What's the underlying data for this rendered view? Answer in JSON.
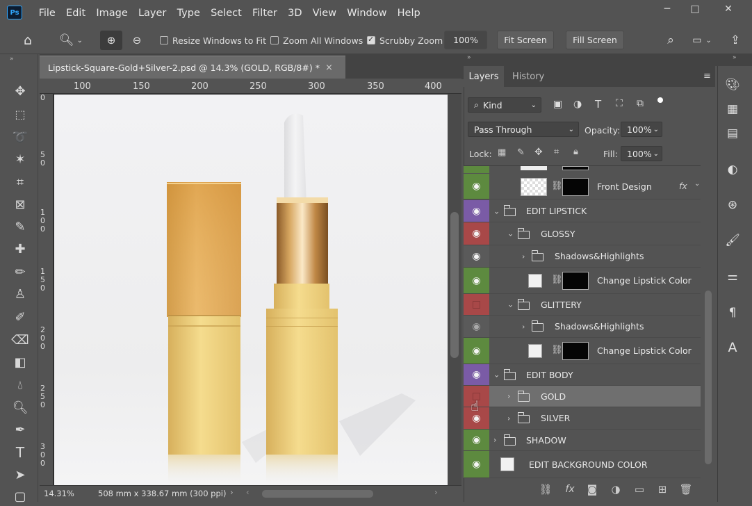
{
  "app": {
    "logo": "Ps"
  },
  "menu": [
    "File",
    "Edit",
    "Image",
    "Layer",
    "Type",
    "Select",
    "Filter",
    "3D",
    "View",
    "Window",
    "Help"
  ],
  "window_controls": {
    "minimize": "─",
    "maximize": "□",
    "close": "✕"
  },
  "options": {
    "resize_windows": "Resize Windows to Fit",
    "zoom_all": "Zoom All Windows",
    "scrubby_zoom": "Scrubby Zoom",
    "zoom_value": "100%",
    "fit_screen": "Fit Screen",
    "fill_screen": "Fill Screen",
    "resize_checked": false,
    "zoom_all_checked": false,
    "scrubby_checked": true
  },
  "document": {
    "tab_title": "Lipstick-Square-Gold+Silver-2.psd @ 14.3% (GOLD, RGB/8#) *",
    "close": "×"
  },
  "ruler": {
    "top": [
      "100",
      "150",
      "200",
      "250",
      "300",
      "350",
      "400"
    ],
    "left": [
      "0",
      "5 0",
      "1 0 0",
      "1 5 0",
      "2 0 0",
      "2 5 0",
      "3 0 0"
    ]
  },
  "status": {
    "zoom": "14.31%",
    "size": "508 mm x 338.67 mm (300 ppi)"
  },
  "layers_panel": {
    "tabs": [
      "Layers",
      "History"
    ],
    "filter_kind": "Kind",
    "blend_mode": "Pass Through",
    "opacity_label": "Opacity:",
    "opacity": "100%",
    "lock_label": "Lock:",
    "fill_label": "Fill:",
    "fill": "100%",
    "fx": "fx",
    "layers": [
      {
        "name": "Front Design",
        "color": "#5d8a3f"
      },
      {
        "name": "EDIT LIPSTICK",
        "color": "#7a5ba6"
      },
      {
        "name": "GLOSSY",
        "color": "#a84848"
      },
      {
        "name": "Shadows&Highlights",
        "color": "#5a5a5a"
      },
      {
        "name": "Change Lipstick Color",
        "color": "#5d8a3f"
      },
      {
        "name": "GLITTERY",
        "color": "#a84848"
      },
      {
        "name": "Shadows&Highlights",
        "color": "#5a5a5a"
      },
      {
        "name": "Change Lipstick Color",
        "color": "#5d8a3f"
      },
      {
        "name": "EDIT BODY",
        "color": "#7a5ba6"
      },
      {
        "name": "GOLD",
        "color": "#a84848"
      },
      {
        "name": "SILVER",
        "color": "#a84848"
      },
      {
        "name": "SHADOW",
        "color": "#5d8a3f"
      },
      {
        "name": "EDIT BACKGROUND COLOR",
        "color": "#5d8a3f"
      }
    ]
  }
}
